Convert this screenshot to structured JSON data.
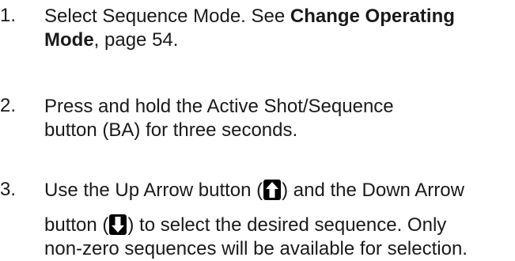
{
  "steps": [
    {
      "number": "1.",
      "text_before": "Select Sequence Mode. See ",
      "link_bold_1": "Change Operating",
      "link_bold_2": "Mode",
      "text_after": ", page 54."
    },
    {
      "number": "2.",
      "line1": "Press and hold the Active Shot/Sequence",
      "line2": "button (BA) for three seconds."
    },
    {
      "number": "3.",
      "line1_a": "Use the Up Arrow button (",
      "line1_b": ") and the Down Arrow",
      "line2_a": "button (",
      "line2_b": ") to select the desired sequence. Only",
      "line3": "non-zero sequences will be available for selection.",
      "up_icon": "up-arrow-icon",
      "down_icon": "down-arrow-icon"
    }
  ]
}
